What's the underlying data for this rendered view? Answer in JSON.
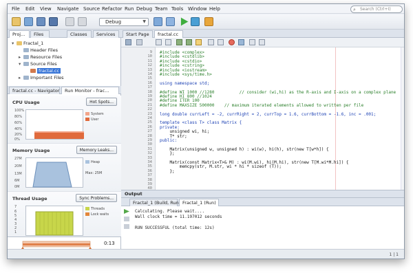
{
  "menu": [
    "File",
    "Edit",
    "View",
    "Navigate",
    "Source",
    "Refactor",
    "Run",
    "Debug",
    "Team",
    "Tools",
    "Window",
    "Help"
  ],
  "search": {
    "placeholder": "Search (Ctrl+I)"
  },
  "toolbar": {
    "config": "Debug"
  },
  "left_tabs": [
    "Proj...",
    "Files",
    "Classes",
    "Services"
  ],
  "tree": [
    {
      "label": "Fractal_1",
      "indent": 0,
      "arrow": "▾"
    },
    {
      "label": "Header Files",
      "indent": 1,
      "arrow": ""
    },
    {
      "label": "Resource Files",
      "indent": 1,
      "arrow": "▸"
    },
    {
      "label": "Source Files",
      "indent": 1,
      "arrow": "▾"
    },
    {
      "label": "fractal.cc",
      "indent": 2,
      "arrow": "",
      "selected": true
    },
    {
      "label": "Important Files",
      "indent": 1,
      "arrow": "▸"
    }
  ],
  "nav_tabs": [
    "fractal.cc - Navigator",
    "Run Monitor - frac..."
  ],
  "monitor": {
    "cpu": {
      "title": "CPU Usage",
      "button": "Hot Spots...",
      "legend": [
        "System",
        "User"
      ],
      "ticks": [
        "100%",
        "80%",
        "60%",
        "40%",
        "20%",
        "0%"
      ]
    },
    "memory": {
      "title": "Memory Usage",
      "button": "Memory Leaks...",
      "legend": [
        "Heap",
        "Max: 25M"
      ],
      "ticks": [
        "27M",
        "20M",
        "13M",
        "6M",
        "0M"
      ]
    },
    "thread": {
      "title": "Thread Usage",
      "button": "Sync Problems...",
      "legend": [
        "Threads",
        "Lock waits"
      ],
      "ticks": [
        "7",
        "6",
        "5",
        "4",
        "3",
        "2",
        "1"
      ]
    },
    "time": "0:13"
  },
  "editor_tabs": [
    "Start Page",
    "fractal.cc"
  ],
  "line_numbers": [
    "9",
    "10",
    "11",
    "12",
    "13",
    "14",
    "15",
    "16",
    "17",
    "18",
    "19",
    "20",
    "21",
    "22",
    "23",
    "24",
    "25",
    "26",
    "27",
    "28",
    "29",
    "30",
    "31",
    "32",
    "33",
    "34",
    "35",
    "36",
    "37",
    "38",
    "39",
    "40"
  ],
  "code": [
    "#include <complex>",
    "#include <cstdlib>",
    "#include <cstdio>",
    "#include <cstring>",
    "#include <iostream>",
    "#include <sys/time.h>",
    "",
    "using namespace std;",
    "",
    "#define WI 1000 //1280          // consider (wi,hi) as the R-axis and I-axis on a complex plane",
    "#define HI 800 //1024",
    "#define ITER 100",
    "#define MAXSIZE 500000    // maximum iterated elements allowed to written per file",
    "",
    "long double currLeft = -2, currRight = 2, currTop = 1.6, currBottom = -1.6, inc = .001;",
    "",
    "template <class T> class Matrix {",
    "private:",
    "    unsigned wi, hi;",
    "    T* str;",
    "public:",
    "",
    "    Matrix(unsigned w, unsigned h) : wi(w), hi(h), str(new T[w*h]) {",
    "    };",
    "",
    "    Matrix(const Matrix<T>& M) : wi(M.wi), hi(M.hi), str(new T[M.wi*M.hi]) {",
    "        memcpy(str, M.str, wi * hi * sizeof (T));",
    "    };",
    ""
  ],
  "output": {
    "title": "Output",
    "tabs": [
      "Fractal_1 (Build, Run)",
      "Fractal_1 (Run)"
    ],
    "lines": [
      "Calculating. Please wait....",
      "Wall clock time = 11.197012 seconds",
      "",
      "RUN SUCCESSFUL (total time: 12s)"
    ]
  },
  "status": {
    "position": "1 | 1"
  }
}
